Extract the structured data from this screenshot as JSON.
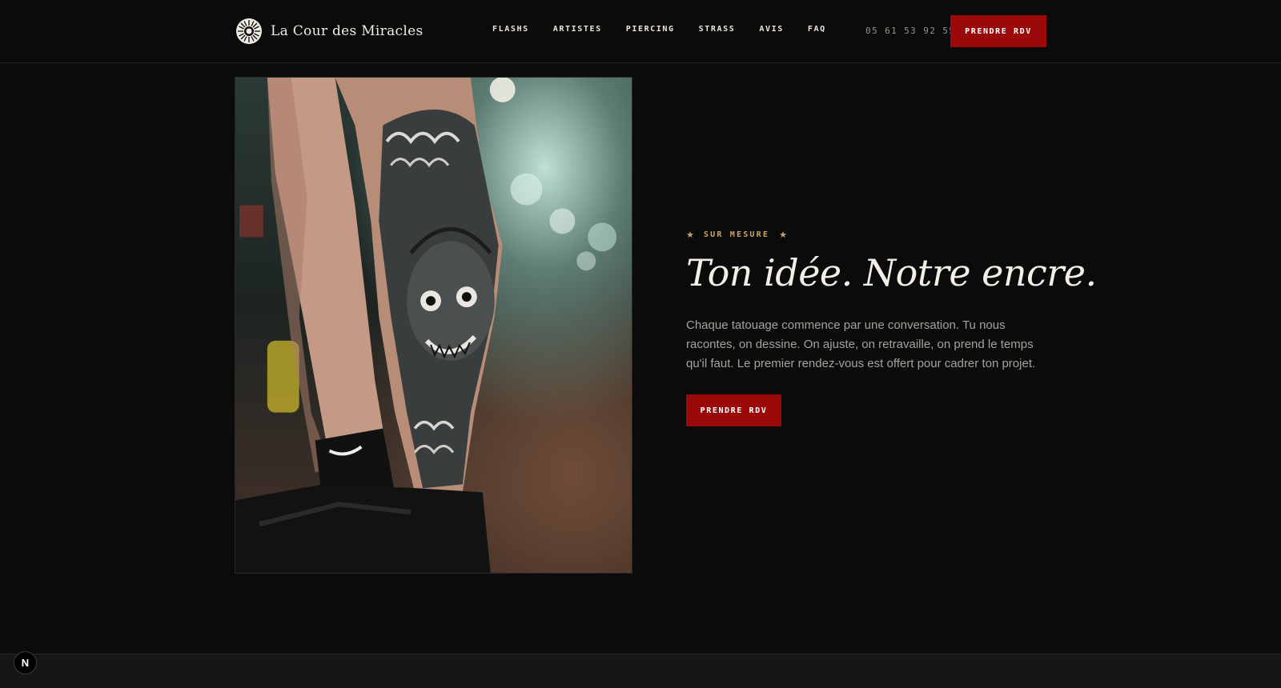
{
  "header": {
    "brand_name": "La Cour des Miracles",
    "nav": [
      "FLASHS",
      "ARTISTES",
      "PIERCING",
      "STRASS",
      "AVIS",
      "FAQ"
    ],
    "phone": "05 61 53 92 55",
    "cta_label": "PRENDRE RDV"
  },
  "hero": {
    "image_alt": "Tatouage japonais masque Hannya sur mollet",
    "eyebrow_star": "★",
    "eyebrow_label": "SUR MESURE",
    "headline": "Ton idée. Notre encre.",
    "paragraph": "Chaque tatouage commence par une conversation. Tu nous racontes, on dessine. On ajuste, on retravaille, on prend le temps qu'il faut. Le premier rendez-vous est offert pour cadrer ton projet.",
    "cta_label": "PRENDRE RDV"
  },
  "dev_badge": {
    "label": "N"
  },
  "colors": {
    "background": "#0b0b0b",
    "accent_red": "#9a0a0a",
    "gold": "#c9a46a",
    "text_light": "#f4efe6",
    "text_muted": "#a7a29a"
  }
}
